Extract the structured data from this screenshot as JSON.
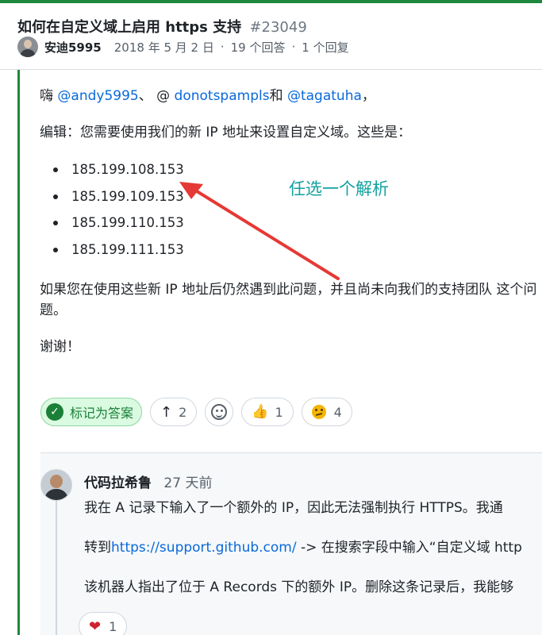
{
  "discussion": {
    "title": "如何在自定义域上启用 https 支持",
    "number": "#23049",
    "author": "安迪5995",
    "date": "2018 年 5 月 2 日",
    "answers": "19 个回答",
    "replies": "1 个回复"
  },
  "answer": {
    "greeting_prefix": "嗨 ",
    "mention_1": "@andy5995",
    "sep_1": "、  @ ",
    "mention_2": "donotspampls",
    "sep_2": "和 ",
    "mention_3": "@tagatuha",
    "sep_3": "，",
    "edit_line": "编辑：您需要使用我们的新 IP 地址来设置自定义域。这些是：",
    "ips": [
      "185.199.108.153",
      "185.199.109.153",
      "185.199.110.153",
      "185.199.111.153"
    ],
    "issue_line": "如果您在使用这些新 IP 地址后仍然遇到此问题，并且尚未向我们的支持团队 这个问题。",
    "thanks": "谢谢！",
    "mark_answer_label": "标记为答案",
    "upvotes": "2",
    "thumbs_up_count": "1",
    "confused_count": "4"
  },
  "annotation": {
    "text": "任选一个解析",
    "color": "#e53935"
  },
  "reply": {
    "author": "代码拉希鲁",
    "time": "27 天前",
    "line_1": "我在 A 记录下输入了一个额外的 IP，因此无法强制执行 HTTPS。我通",
    "line_2_prefix": "转到",
    "line_2_link": "https://support.github.com/",
    "line_2_suffix": " -> 在搜索字段中输入“自定义域 http",
    "line_3": "该机器人指出了位于 A Records 下的额外 IP。删除这条记录后，我能够",
    "heart_count": "1"
  },
  "colors": {
    "accent_green": "#1f883d",
    "link_blue": "#0969da",
    "annotation_teal": "#12a1a0"
  }
}
